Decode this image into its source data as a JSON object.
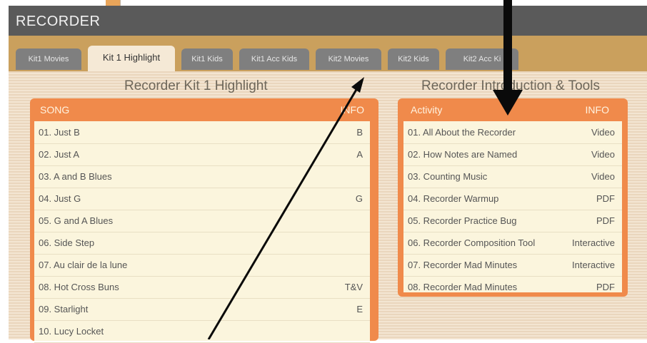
{
  "window": {
    "title": "RECORDER"
  },
  "tabs": [
    {
      "label": "Kit1 Movies",
      "active": false
    },
    {
      "label": "Kit 1 Highlight",
      "active": true
    },
    {
      "label": "Kit1 Kids",
      "active": false
    },
    {
      "label": "Kit1 Acc Kids",
      "active": false
    },
    {
      "label": "Kit2 Movies",
      "active": false
    },
    {
      "label": "Kit2 Kids",
      "active": false
    },
    {
      "label": "Kit2 Acc Ki",
      "active": false
    }
  ],
  "left": {
    "title": "Recorder Kit 1 Highlight",
    "col1": "SONG",
    "col2": "INFO",
    "rows": [
      {
        "name": "01. Just B",
        "info": "B"
      },
      {
        "name": "02. Just A",
        "info": "A"
      },
      {
        "name": "03. A and B Blues",
        "info": ""
      },
      {
        "name": "04. Just G",
        "info": "G"
      },
      {
        "name": "05. G and A Blues",
        "info": ""
      },
      {
        "name": "06. Side Step",
        "info": ""
      },
      {
        "name": "07. Au clair de la lune",
        "info": ""
      },
      {
        "name": "08. Hot Cross Buns",
        "info": "T&V"
      },
      {
        "name": "09. Starlight",
        "info": "E"
      },
      {
        "name": "10. Lucy Locket",
        "info": ""
      }
    ]
  },
  "right": {
    "title": "Recorder Introduction & Tools",
    "col1": "Activity",
    "col2": "INFO",
    "rows": [
      {
        "name": "01. All About the Recorder",
        "info": "Video"
      },
      {
        "name": "02. How Notes are Named",
        "info": "Video"
      },
      {
        "name": "03. Counting Music",
        "info": "Video"
      },
      {
        "name": "04. Recorder Warmup",
        "info": "PDF"
      },
      {
        "name": "05. Recorder Practice Bug",
        "info": "PDF"
      },
      {
        "name": "06. Recorder Composition Tool",
        "info": "Interactive"
      },
      {
        "name": "07. Recorder Mad Minutes",
        "info": "Interactive"
      },
      {
        "name": "08. Recorder Mad Minutes",
        "info": "PDF"
      }
    ]
  },
  "colors": {
    "title_bar": "#5a5a5a",
    "tab_bar": "#caa05d",
    "accent_orange": "#f08a4b",
    "row_bg": "#fbf5dd"
  }
}
